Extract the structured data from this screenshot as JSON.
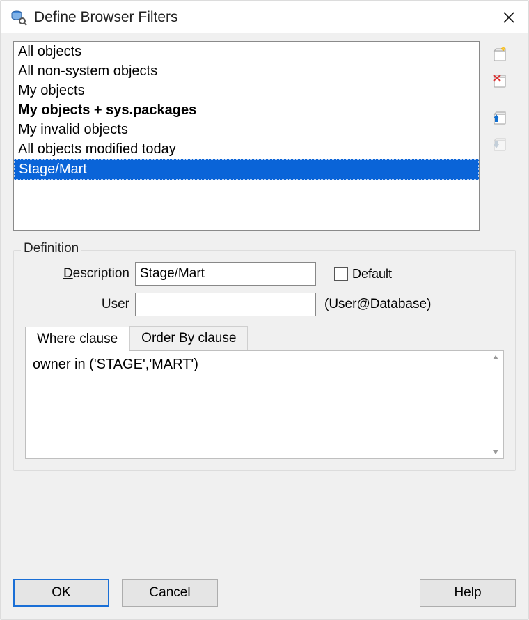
{
  "dialog": {
    "title": "Define Browser Filters"
  },
  "filters": [
    {
      "label": "All objects",
      "bold": false,
      "selected": false
    },
    {
      "label": "All non-system objects",
      "bold": false,
      "selected": false
    },
    {
      "label": "My objects",
      "bold": false,
      "selected": false
    },
    {
      "label": "My objects + sys.packages",
      "bold": true,
      "selected": false
    },
    {
      "label": "My invalid objects",
      "bold": false,
      "selected": false
    },
    {
      "label": "All objects modified today",
      "bold": false,
      "selected": false
    },
    {
      "label": "Stage/Mart",
      "bold": false,
      "selected": true
    }
  ],
  "side_tools": {
    "new_label": "new-filter-icon",
    "delete_label": "delete-filter-icon",
    "up_label": "move-up-icon",
    "down_label": "move-down-icon",
    "down_disabled": true
  },
  "definition": {
    "group_label": "Definition",
    "description_label_pre": "D",
    "description_label_post": "escription",
    "description_value": "Stage/Mart",
    "default_label": "Default",
    "default_checked": false,
    "user_label_pre": "U",
    "user_label_post": "ser",
    "user_value": "",
    "user_hint": "(User@Database)",
    "tabs": {
      "where_label": "Where clause",
      "orderby_label": "Order By clause",
      "active": "where",
      "where_text": "owner in ('STAGE','MART')"
    }
  },
  "buttons": {
    "ok": "OK",
    "cancel": "Cancel",
    "help": "Help"
  },
  "colors": {
    "selection": "#0a64d8",
    "primary_border": "#1a6fd6"
  }
}
